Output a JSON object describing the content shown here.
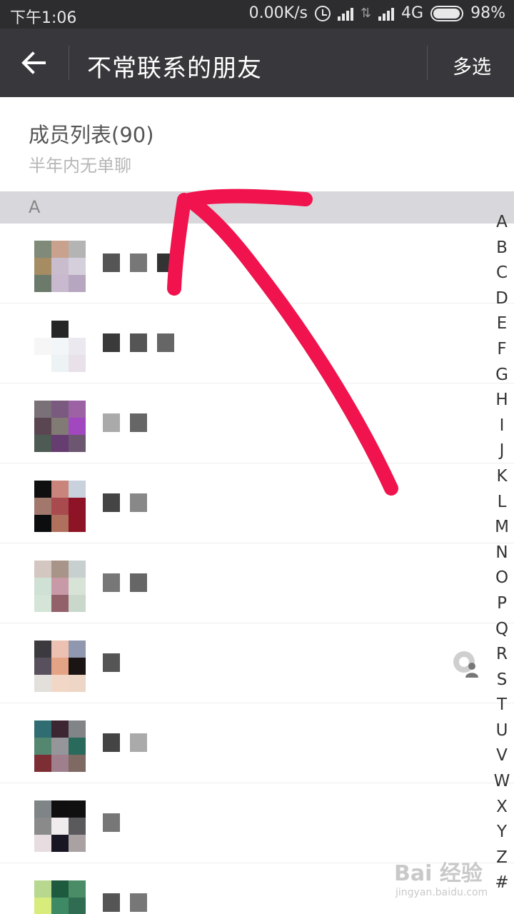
{
  "status_bar": {
    "time": "下午1:06",
    "network_speed": "0.00K/s",
    "network_type": "4G",
    "battery": "98%",
    "battery_level": 0.98
  },
  "title_bar": {
    "back_icon": "arrow-left-icon",
    "title": "不常联系的朋友",
    "multi_select": "多选"
  },
  "member_list": {
    "title": "成员列表(90)",
    "subtitle": "半年内无单聊"
  },
  "section_letter": "A",
  "contacts": [
    {
      "avatar_colors": [
        "#7f8a78",
        "#c9a28e",
        "#b4b4b4",
        "#a58c63",
        "#c9bccd",
        "#d5cfdc",
        "#6b7a6a",
        "#c8b9cf",
        "#b7a6bf"
      ],
      "name_blocks": [
        "#555555",
        "#777777",
        "#333333"
      ],
      "icon": null
    },
    {
      "avatar_colors": [
        "#ffffff",
        "#262626",
        "#ffffff",
        "#f6f6f6",
        "#f2f6f8",
        "#ece8ef",
        "#ffffff",
        "#edf2f4",
        "#e8e1ea"
      ],
      "name_blocks": [
        "#3a3a3a",
        "#555555",
        "#666666"
      ],
      "icon": null
    },
    {
      "avatar_colors": [
        "#7a7077",
        "#7a5a7e",
        "#9c62a4",
        "#5a4650",
        "#827a74",
        "#a147c0",
        "#4d5b54",
        "#663d71",
        "#6d5770"
      ],
      "name_blocks": [
        "#aaaaaa",
        "#666666"
      ],
      "icon": null
    },
    {
      "avatar_colors": [
        "#0f0f0f",
        "#c9847c",
        "#c9d1dd",
        "#a2776c",
        "#a84a4e",
        "#8e1326",
        "#0c0d0e",
        "#b0705e",
        "#8d1424"
      ],
      "name_blocks": [
        "#444444",
        "#888888"
      ],
      "icon": null
    },
    {
      "avatar_colors": [
        "#d4c6c0",
        "#a99489",
        "#c7cfcf",
        "#cfe0d4",
        "#c89aa8",
        "#d7e3d7",
        "#d4e4d6",
        "#93616a",
        "#c9d8ca"
      ],
      "name_blocks": [
        "#777777",
        "#666666"
      ],
      "icon": null
    },
    {
      "avatar_colors": [
        "#3c3a3f",
        "#edc1b2",
        "#8f98ae",
        "#58505c",
        "#e4a384",
        "#1a1413",
        "#e3e0db",
        "#f2d7c7",
        "#eed6c6"
      ],
      "name_blocks": [
        "#555555"
      ],
      "icon": "person-camera-icon"
    },
    {
      "avatar_colors": [
        "#2f6d72",
        "#3c2631",
        "#818588",
        "#53876f",
        "#96969a",
        "#2a6a5d",
        "#7d2e35",
        "#9e7f8b",
        "#7e6963"
      ],
      "name_blocks": [
        "#444444",
        "#aaaaaa"
      ],
      "icon": null
    },
    {
      "avatar_colors": [
        "#7f8486",
        "#0f0f10",
        "#101010",
        "#8a8a8b",
        "#f0ecee",
        "#5a5a5d",
        "#e7dde0",
        "#191624",
        "#aaa1a3"
      ],
      "name_blocks": [
        "#777777"
      ],
      "icon": null
    },
    {
      "avatar_colors": [
        "#b7d88e",
        "#1e5a3d",
        "#4a8c66",
        "#d7ec7a",
        "#3e8a64",
        "#2f6c52",
        "#c8e06e",
        "#4f9c73",
        "#3b7c5d"
      ],
      "name_blocks": [
        "#555555",
        "#777777"
      ],
      "icon": null
    }
  ],
  "index_letters": [
    "A",
    "B",
    "C",
    "D",
    "E",
    "F",
    "G",
    "H",
    "I",
    "J",
    "K",
    "L",
    "M",
    "N",
    "O",
    "P",
    "Q",
    "R",
    "S",
    "T",
    "U",
    "V",
    "W",
    "X",
    "Y",
    "Z",
    "#"
  ],
  "annotation": {
    "stroke_color": "#f0134d"
  },
  "watermark": {
    "logo": "Bai 经验",
    "url": "jingyan.baidu.com"
  }
}
